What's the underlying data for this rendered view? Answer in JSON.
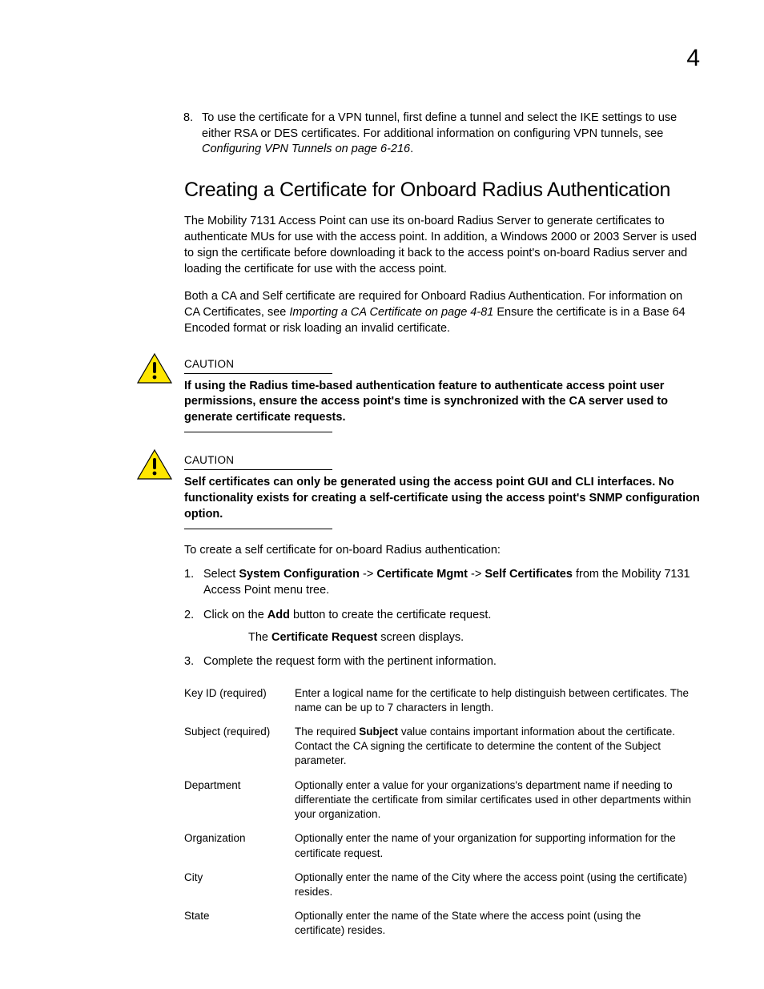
{
  "chapterNumber": "4",
  "step8": {
    "num": "8.",
    "pre": "To use the certificate for a VPN tunnel, first define a tunnel and select the IKE settings to use either RSA or DES certificates. For additional information on configuring VPN tunnels, see ",
    "ref": "Configuring VPN Tunnels on page 6-216",
    "post": "."
  },
  "sectionTitle": "Creating a Certificate for Onboard Radius Authentication",
  "para1": "The Mobility 7131 Access Point can use its on-board Radius Server to generate certificates to authenticate MUs for use with the access point. In addition, a Windows 2000 or 2003 Server is used to sign the certificate before downloading it back to the access point's on-board Radius server and loading the certificate for use with the access point.",
  "para2": {
    "pre": "Both a CA and Self certificate are required for Onboard Radius Authentication. For information on CA Certificates, see ",
    "ref": "Importing a CA Certificate on page 4-81",
    "post": "  Ensure the certificate is in a Base 64 Encoded format or risk loading an invalid certificate."
  },
  "caution1": {
    "label": "CAUTION",
    "text": "If using the Radius time-based authentication feature to authenticate access point user permissions, ensure the access point's time is synchronized with the CA server used to generate certificate requests."
  },
  "caution2": {
    "label": "CAUTION",
    "text": "Self certificates can only be generated using the access point GUI and CLI interfaces. No functionality exists for creating a self-certificate using the access point's SNMP configuration option."
  },
  "introLine": "To create a self certificate for on-board Radius authentication:",
  "steps": {
    "s1": {
      "num": "1.",
      "pre": "Select ",
      "b1": "System Configuration",
      "a1": " -> ",
      "b2": "Certificate Mgmt",
      "a2": " -> ",
      "b3": "Self Certificates",
      "post": " from the Mobility 7131 Access Point menu tree."
    },
    "s2": {
      "num": "2.",
      "pre": "Click on the ",
      "b1": "Add",
      "post": " button to create the certificate request."
    },
    "s2sub": {
      "pre": "The ",
      "b1": "Certificate Request",
      "post": " screen displays."
    },
    "s3": {
      "num": "3.",
      "text": "Complete the request form with the pertinent information."
    }
  },
  "fields": {
    "keyId": {
      "name": "Key ID (required)",
      "desc": "Enter a logical name for the certificate to help distinguish between certificates. The name can be up to 7 characters in length."
    },
    "subject": {
      "name": "Subject (required)",
      "pre": "The required ",
      "b1": "Subject",
      "post": " value contains important information about the certificate. Contact the CA signing the certificate to determine the content of the Subject parameter."
    },
    "department": {
      "name": "Department",
      "desc": "Optionally enter a value for your organizations's department name if needing to differentiate the certificate from similar certificates used in other departments within your organization."
    },
    "organization": {
      "name": "Organization",
      "desc": "Optionally enter the name of your organization for supporting information for the certificate request."
    },
    "city": {
      "name": "City",
      "desc": "Optionally enter the name of the City where the access point (using the certificate) resides."
    },
    "state": {
      "name": "State",
      "desc": "Optionally enter the name of the State where the access point (using the certificate) resides."
    }
  }
}
